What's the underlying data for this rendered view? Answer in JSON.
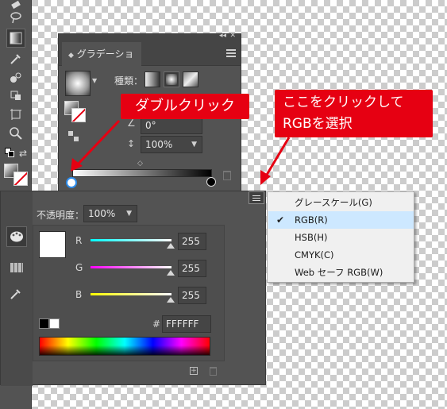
{
  "gradient_panel": {
    "tab_title": "グラデーション",
    "type_label": "種類：",
    "angle_value": "0°",
    "aspect_value": "100%"
  },
  "callouts": {
    "double_click": "ダブルクリック",
    "click_here_line1": "ここをクリックして",
    "click_here_line2": "RGBを選択"
  },
  "color_panel": {
    "opacity_label": "不透明度：",
    "opacity_value": "100%",
    "channels": [
      {
        "label": "R",
        "value": "255",
        "color": "#00ffff"
      },
      {
        "label": "G",
        "value": "255",
        "color": "#ff00ff"
      },
      {
        "label": "B",
        "value": "255",
        "color": "#ffff00"
      }
    ],
    "hex_label": "#",
    "hex_value": "FFFFFF"
  },
  "flyout_menu": {
    "items": [
      {
        "label": "グレースケール(G)",
        "checked": false
      },
      {
        "label": "RGB(R)",
        "checked": true
      },
      {
        "label": "HSB(H)",
        "checked": false
      },
      {
        "label": "CMYK(C)",
        "checked": false
      },
      {
        "label": "Web セーフ RGB(W)",
        "checked": false
      }
    ]
  },
  "colors": {
    "callout_red": "#e60012",
    "panel_bg": "#535353",
    "menu_highlight": "#cde8ff"
  }
}
